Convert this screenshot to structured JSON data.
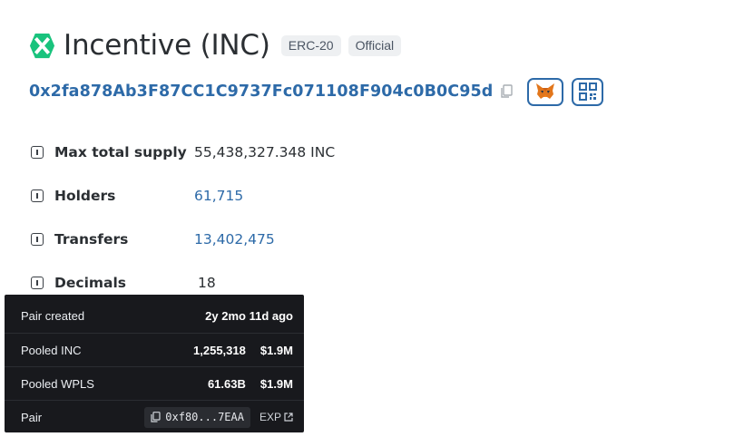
{
  "token": {
    "title": "Incentive (INC)",
    "tags": [
      "ERC-20",
      "Official"
    ],
    "address": "0x2fa878Ab3F87CC1C9737Fc071108F904c0B0C95d",
    "logo_icon": "incentive-x-logo",
    "accent_color": "#2d6aa8",
    "logo_color": "#19c37d"
  },
  "properties": [
    {
      "label": "Max total supply",
      "value": "55,438,327.348 INC"
    },
    {
      "label": "Holders",
      "value": "61,715"
    },
    {
      "label": "Transfers",
      "value": "13,402,475"
    },
    {
      "label": "Decimals",
      "value": "18"
    }
  ],
  "tooltip": {
    "pair_created_label": "Pair created",
    "pair_created_value": "2y 2mo 11d ago",
    "pooled_inc_label": "Pooled INC",
    "pooled_inc_amount": "1,255,318",
    "pooled_inc_usd": "$1.9M",
    "pooled_wpls_label": "Pooled WPLS",
    "pooled_wpls_amount": "61.63B",
    "pooled_wpls_usd": "$1.9M",
    "pair_label": "Pair",
    "pair_address": "0xf80...7EAA",
    "exp_label": "EXP"
  }
}
